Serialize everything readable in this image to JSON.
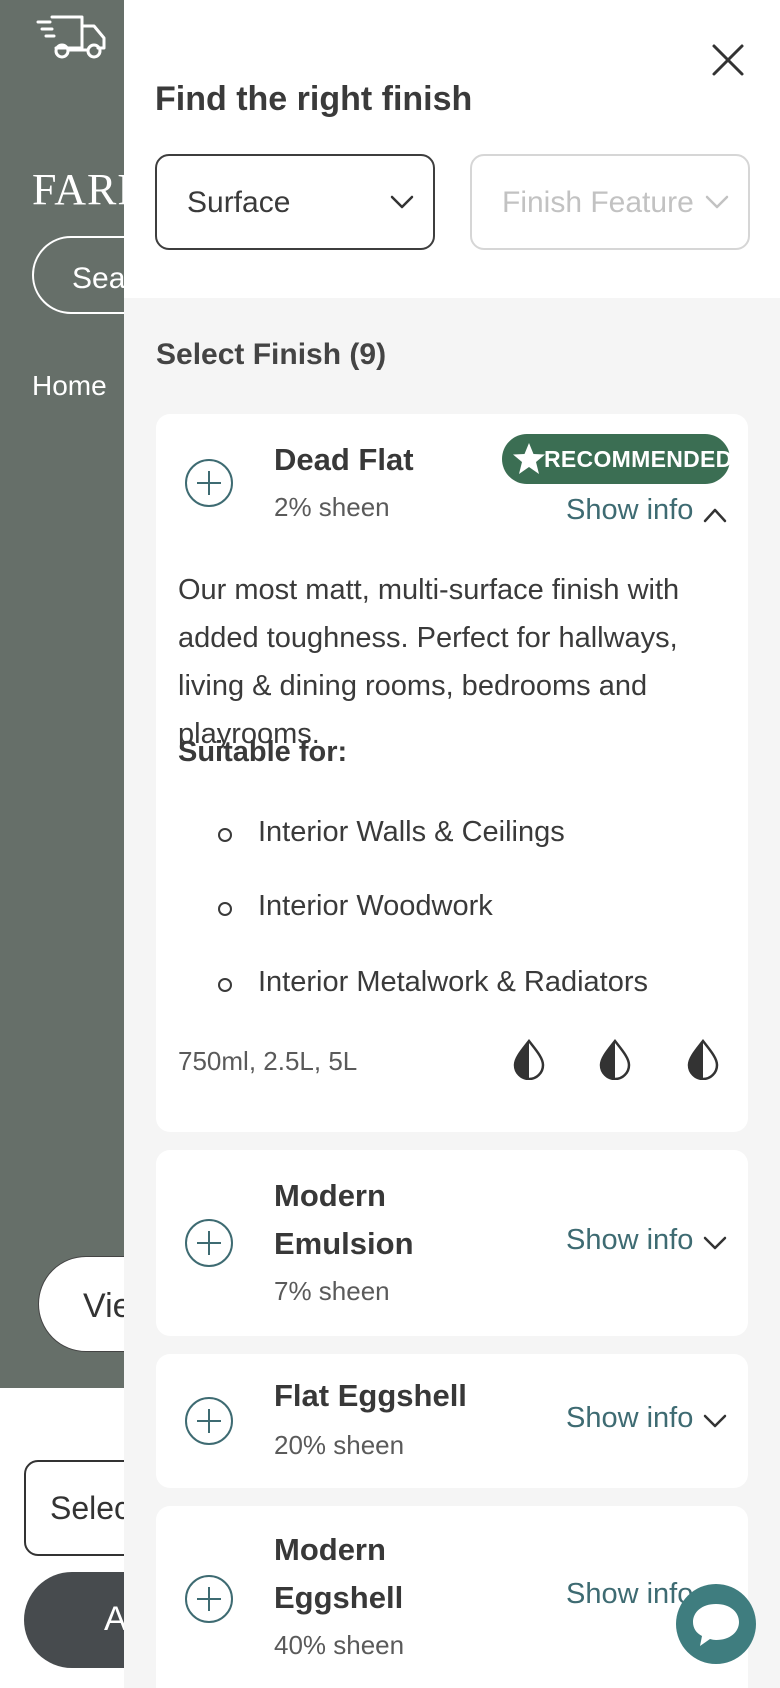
{
  "background": {
    "logo_text": "FARR",
    "search_label": "Sear",
    "nav_home": "Home",
    "view_button": "Vie",
    "select_label": "Select",
    "add_button": "A"
  },
  "drawer": {
    "title": "Find the right finish",
    "surface_dropdown": "Surface",
    "finish_feature_dropdown": "Finish Feature",
    "select_finish_heading": "Select Finish (9)"
  },
  "finishes": [
    {
      "name": "Dead Flat",
      "sheen": "2% sheen",
      "badge": "RECOMMENDED",
      "show_info": "Show info",
      "expanded": true,
      "description": "Our most matt, multi-surface finish with added toughness. Perfect for hallways, living & dining rooms, bedrooms and playrooms.",
      "suitable_heading": "Suitable for:",
      "suitable_for": [
        "Interior Walls & Ceilings",
        "Interior Woodwork",
        "Interior Metalwork & Radiators"
      ],
      "sizes": "750ml, 2.5L, 5L"
    },
    {
      "name_line1": "Modern",
      "name_line2": "Emulsion",
      "sheen": "7% sheen",
      "show_info": "Show info"
    },
    {
      "name": "Flat Eggshell",
      "sheen": "20% sheen",
      "show_info": "Show info"
    },
    {
      "name_line1": "Modern",
      "name_line2": "Eggshell",
      "sheen": "40% sheen",
      "show_info": "Show info"
    }
  ],
  "colors": {
    "background_green": "#666f69",
    "badge_green": "#3b6e53",
    "link_teal": "#3e6b72",
    "chat_teal": "#3f7d7f"
  },
  "icons": [
    "truck-icon",
    "close-icon",
    "chevron-down-icon",
    "chevron-up-icon",
    "plus-circle-icon",
    "star-icon",
    "drop-icon",
    "chat-icon"
  ]
}
